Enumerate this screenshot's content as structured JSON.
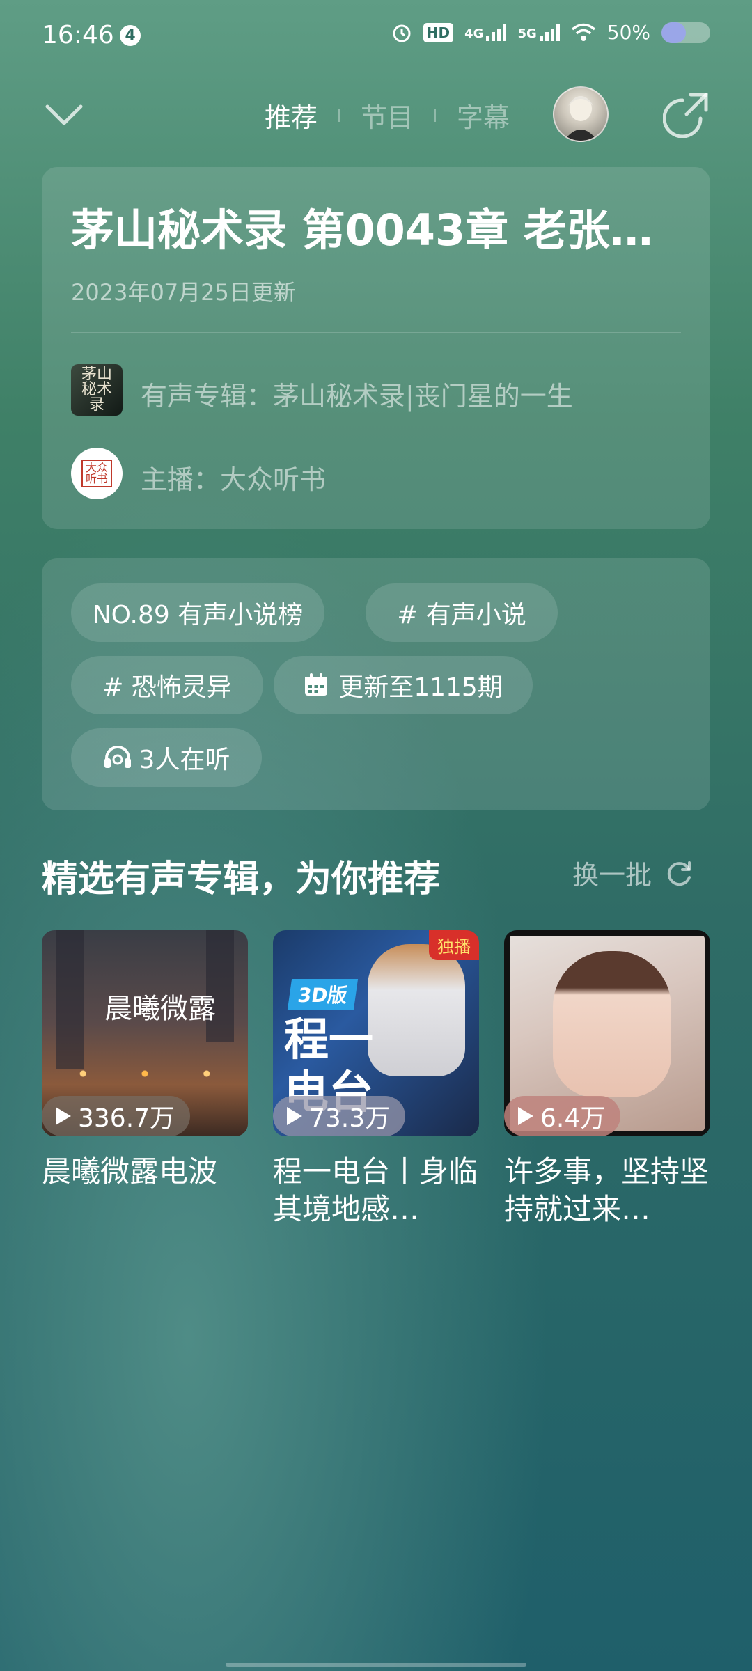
{
  "status_bar": {
    "time": "16:46",
    "notification_count": "4",
    "hd_label": "HD",
    "net1": "4G",
    "net2": "5G",
    "battery_text": "50%",
    "battery_level": 0.5
  },
  "nav": {
    "tabs": [
      {
        "label": "推荐",
        "active": true
      },
      {
        "label": "节目",
        "active": false
      },
      {
        "label": "字幕",
        "active": false
      }
    ]
  },
  "episode": {
    "title": "茅山秘术录 第0043章 老张…",
    "updated": "2023年07月25日更新",
    "album_label": "有声专辑：茅山秘术录|丧门星的一生",
    "album_thumb_text": "茅山秘术录",
    "host_label": "主播：大众听书",
    "host_badge": "大众听书"
  },
  "tags": {
    "ranking": "NO.89 有声小说榜",
    "tag1": "# 有声小说",
    "tag2": "# 恐怖灵异",
    "updates": "更新至1115期",
    "listeners": "3人在听"
  },
  "section": {
    "title": "精选有声专辑，为你推荐",
    "refresh_label": "换一批"
  },
  "albums": [
    {
      "title": "晨曦微露电波",
      "plays": "336.7万",
      "cover_text": "晨曦微露"
    },
    {
      "title": "程一电台丨身临其境地感…",
      "plays": "73.3万",
      "cover_text": "程一电台",
      "badge": "3D版",
      "exclusive": "独播"
    },
    {
      "title": "许多事，坚持坚持就过来…",
      "plays": "6.4万"
    }
  ],
  "colors": {
    "bg_top": "#5f9d85",
    "bg_bottom": "#1f5f6a",
    "accent_battery": "#9aa6e8",
    "exclusive_red": "#d8302a"
  }
}
